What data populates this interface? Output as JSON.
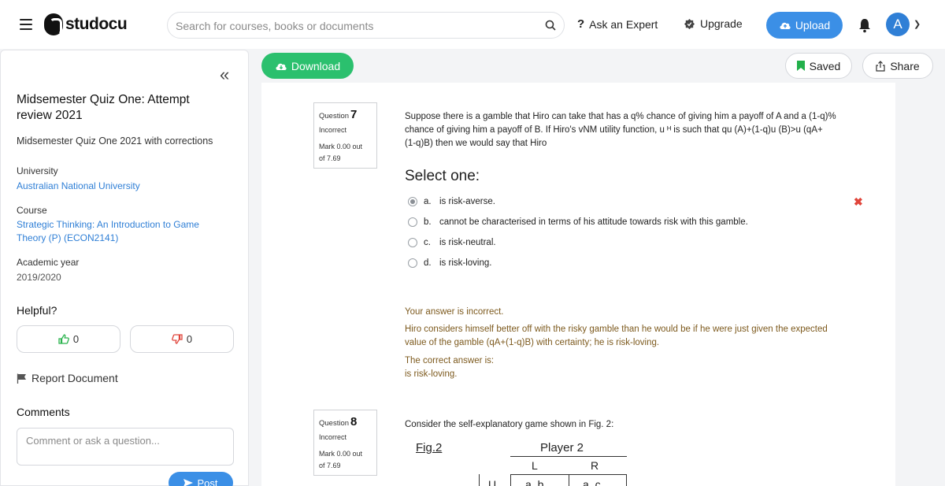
{
  "header": {
    "logo_text": "studocu",
    "search_placeholder": "Search for courses, books or documents",
    "ask_expert": "Ask an Expert",
    "upgrade": "Upgrade",
    "upload": "Upload",
    "avatar_initial": "A"
  },
  "sidebar": {
    "title": "Midsemester Quiz One: Attempt review 2021",
    "subtitle": "Midsemester Quiz One 2021 with corrections",
    "university_label": "University",
    "university": "Australian National University",
    "course_label": "Course",
    "course": "Strategic Thinking: An Introduction to Game Theory (P) (ECON2141)",
    "year_label": "Academic year",
    "year": "2019/2020",
    "helpful_label": "Helpful?",
    "upvotes": "0",
    "downvotes": "0",
    "report": "Report Document",
    "comments_label": "Comments",
    "comment_placeholder": "Comment or ask a question...",
    "post": "Post"
  },
  "actions": {
    "download": "Download",
    "saved": "Saved",
    "share": "Share"
  },
  "question7": {
    "label": "Question",
    "number": "7",
    "state": "Incorrect",
    "mark_line1": "Mark 0.00 out",
    "mark_line2": "of 7.69",
    "text_line1": "Suppose there is a gamble that Hiro can take that has a q% chance of giving him a payoff of A and a (1-q)%",
    "text_line2": "chance of giving him a payoff of B.  If Hiro's vNM utility function, u ᴴ is such that qu  (A)+(1-q)u  (B)>u  (qA+",
    "text_line3": "(1-q)B) then we would say that Hiro",
    "select_one": "Select one:",
    "options": [
      {
        "letter": "a.",
        "text": "is risk-averse."
      },
      {
        "letter": "b.",
        "text": "cannot be characterised in terms of his attitude towards risk with this gamble."
      },
      {
        "letter": "c.",
        "text": "is risk-neutral."
      },
      {
        "letter": "d.",
        "text": "is risk-loving."
      }
    ],
    "feedback_incorrect": "Your answer is incorrect.",
    "explanation_line1": "Hiro considers himself better off with the risky gamble than he would be if he were just given the expected",
    "explanation_line2": "value of the gamble (qA+(1-q)B) with certainty; he is risk-loving.",
    "correct_label": "The correct answer is:",
    "correct_answer": "is risk-loving."
  },
  "question8": {
    "label": "Question",
    "number": "8",
    "state": "Incorrect",
    "mark_line1": "Mark 0.00 out",
    "mark_line2": "of 7.69",
    "text": "Consider the self-explanatory game shown in Fig. 2:",
    "fig_label": "Fig.2",
    "player": "Player 2",
    "col_left": "L",
    "col_right": "R",
    "row_top": "U",
    "cell_1": "a, b",
    "cell_2": "a, c"
  },
  "colors": {
    "upload_blue": "#3b8fe6",
    "download_green": "#2bc06e",
    "link_blue": "#2f7fd6",
    "feedback_brown": "#7d5a1e",
    "wrong_red": "#e0443a"
  }
}
